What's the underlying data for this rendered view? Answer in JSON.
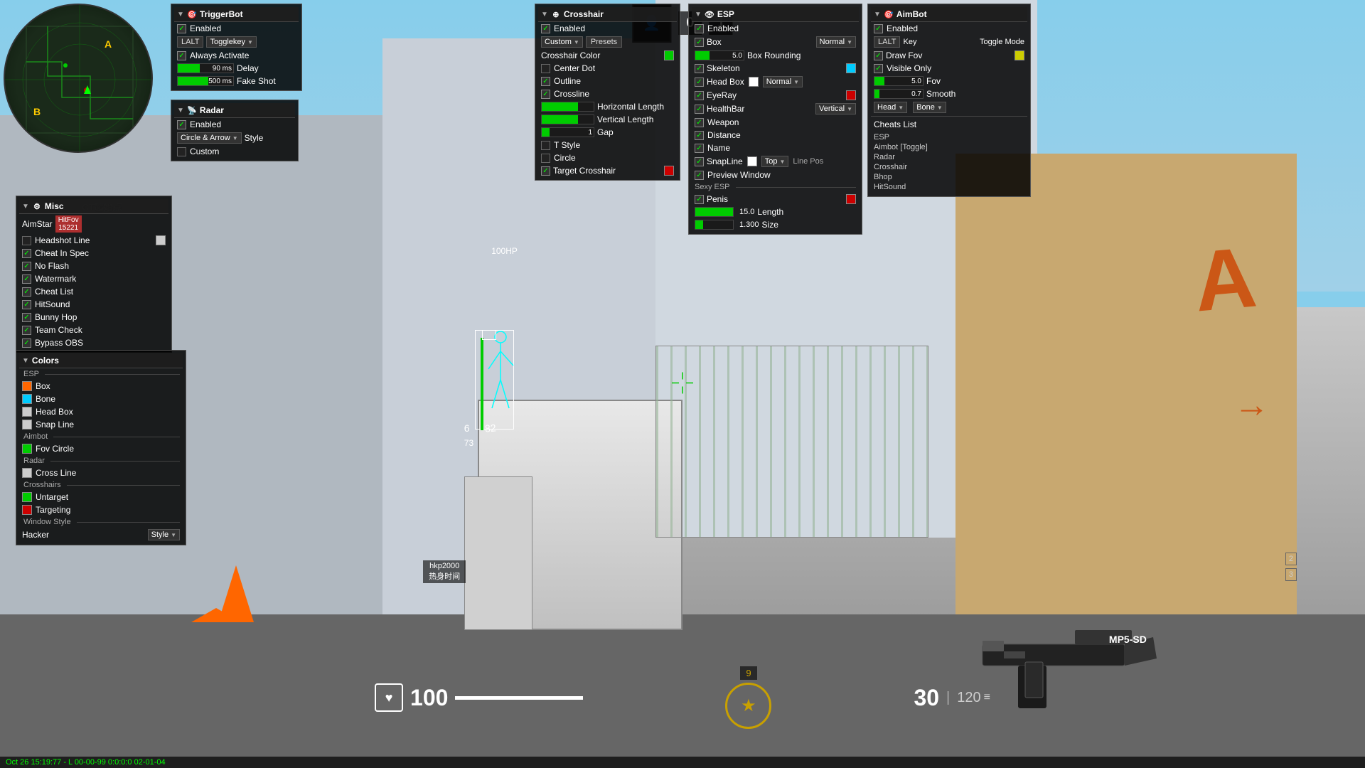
{
  "game": {
    "bg_color": "#87CEEB",
    "player_name": "hkp2000",
    "player_subtitle": "热身时间",
    "hp": "100",
    "ammo_current": "30",
    "ammo_reserve": "120",
    "round_number": "9",
    "kills": "0",
    "deaths": "1"
  },
  "status_bar": {
    "text": "Oct 26 15:19:77 - L 00-00-99 0:0:0:0 02-01-04"
  },
  "radar_map": {
    "title": "Radar",
    "icon": "📡"
  },
  "triggerbot": {
    "title": "TriggerBot",
    "icon": "🎯",
    "enabled_label": "Enabled",
    "enabled": true,
    "lalt_label": "LALT",
    "togglekey_label": "Togglekey",
    "always_activate_label": "Always Activate",
    "delay_label": "Delay",
    "delay_value": "90 ms",
    "fake_shot_label": "Fake Shot",
    "fake_shot_value": "500 ms"
  },
  "radar_panel": {
    "title": "Radar",
    "icon": "📡",
    "enabled_label": "Enabled",
    "enabled": true,
    "style_label": "Style",
    "style_value": "Circle & Arrow",
    "custom_label": "Custom"
  },
  "misc": {
    "title": "Misc",
    "icon": "⚙",
    "aimstar_label": "AimStar",
    "aimstar_value": "HitFov",
    "aimstar_num": "15221",
    "headshot_line_label": "Headshot Line",
    "cheat_in_spec_label": "Cheat In Spec",
    "no_flash_label": "No Flash",
    "watermark_label": "Watermark",
    "cheat_list_label": "Cheat List",
    "hitsound_label": "HitSound",
    "bunny_hop_label": "Bunny Hop",
    "team_check_label": "Team Check",
    "bypass_obs_label": "Bypass OBS",
    "headshot_checked": false,
    "cheat_in_spec_checked": true,
    "no_flash_checked": true,
    "watermark_checked": true,
    "cheat_list_checked": true,
    "hitsound_checked": true,
    "bunny_hop_checked": true,
    "team_check_checked": true,
    "bypass_obs_checked": true
  },
  "colors": {
    "title": "Colors",
    "sections": [
      {
        "label": "ESP",
        "is_header": true
      },
      {
        "label": "Box",
        "color": "#ff6600",
        "is_header": false
      },
      {
        "label": "Bone",
        "color": "#00ccff",
        "is_header": false
      },
      {
        "label": "Head Box",
        "color": "#cccccc",
        "is_header": false
      },
      {
        "label": "Snap Line",
        "color": "#cccccc",
        "is_header": false
      },
      {
        "label": "Aimbot",
        "is_header": true
      },
      {
        "label": "Fov Circle",
        "color": "#00cc00",
        "is_header": false
      },
      {
        "label": "Radar",
        "is_header": true
      },
      {
        "label": "Cross Line",
        "color": "#cccccc",
        "is_header": false
      },
      {
        "label": "Crosshairs",
        "is_header": true
      },
      {
        "label": "Untarget",
        "color": "#00cc00",
        "is_header": false
      },
      {
        "label": "Targeting",
        "color": "#cc0000",
        "is_header": false
      },
      {
        "label": "Window Style",
        "is_header": true
      },
      {
        "label": "Hacker",
        "color": null,
        "is_header": false,
        "has_style_dropdown": true
      }
    ]
  },
  "crosshair": {
    "title": "Crosshair",
    "icon": "⊕",
    "enabled_label": "Enabled",
    "enabled": true,
    "custom_label": "Custom",
    "presets_label": "Presets",
    "crosshair_color_label": "Crosshair Color",
    "crosshair_color": "#00cc00",
    "center_dot_label": "Center Dot",
    "center_dot_checked": false,
    "outline_label": "Outline",
    "outline_checked": true,
    "crossline_label": "Crossline",
    "crossline_checked": true,
    "horizontal_length_label": "Horizontal Length",
    "vertical_length_label": "Vertical Length",
    "gap_label": "Gap",
    "gap_value": "1",
    "t_style_label": "T Style",
    "t_style_checked": false,
    "circle_label": "Circle",
    "circle_checked": false,
    "target_crosshair_label": "Target Crosshair",
    "target_crosshair_checked": true,
    "target_crosshair_color": "#cc0000"
  },
  "esp": {
    "title": "ESP",
    "icon": "👁",
    "enabled_label": "Enabled",
    "enabled": true,
    "box_label": "Box",
    "box_checked": true,
    "box_style": "Normal",
    "box_rounding_label": "Box Rounding",
    "box_rounding_value": "5.0",
    "skeleton_label": "Skeleton",
    "skeleton_color": "#00ccff",
    "skeleton_checked": true,
    "head_box_label": "Head Box",
    "head_box_checked": true,
    "head_box_color": "#ffffff",
    "head_box_style": "Normal",
    "eyeray_label": "EyeRay",
    "eyeray_checked": true,
    "eyeray_color": "#cc0000",
    "healthbar_label": "HealthBar",
    "healthbar_checked": true,
    "healthbar_style": "Vertical",
    "weapon_label": "Weapon",
    "weapon_checked": true,
    "distance_label": "Distance",
    "distance_checked": true,
    "name_label": "Name",
    "name_checked": true,
    "snapline_label": "SnapLine",
    "snapline_checked": true,
    "snapline_color": "#ffffff",
    "snapline_pos": "Top",
    "line_pos_label": "Line Pos",
    "preview_window_label": "Preview Window",
    "preview_window_checked": true,
    "sexy_esp_label": "Sexy ESP",
    "penis_label": "Penis",
    "penis_checked": true,
    "penis_color": "#cc0000",
    "length_label": "Length",
    "length_value": "15.0",
    "size_label": "Size",
    "size_value": "1.300"
  },
  "aimbot": {
    "title": "AimBot",
    "icon": "🎯",
    "enabled_label": "Enabled",
    "enabled": true,
    "lalt_label": "LALT",
    "key_label": "Key",
    "toggle_mode_label": "Toggle Mode",
    "draw_fov_label": "Draw Fov",
    "draw_fov_color": "#cccc00",
    "visible_only_label": "Visible Only",
    "visible_only_checked": true,
    "fov_label": "Fov",
    "fov_value": "5.0",
    "smooth_label": "Smooth",
    "smooth_value": "0.7",
    "head_label": "Head",
    "bone_label": "Bone",
    "cheats_list_label": "Cheats List",
    "cheats_list_items": [
      "ESP",
      "Aimbot [Toggle]",
      "Radar",
      "Crosshair",
      "Bhop",
      "HitSound"
    ]
  }
}
